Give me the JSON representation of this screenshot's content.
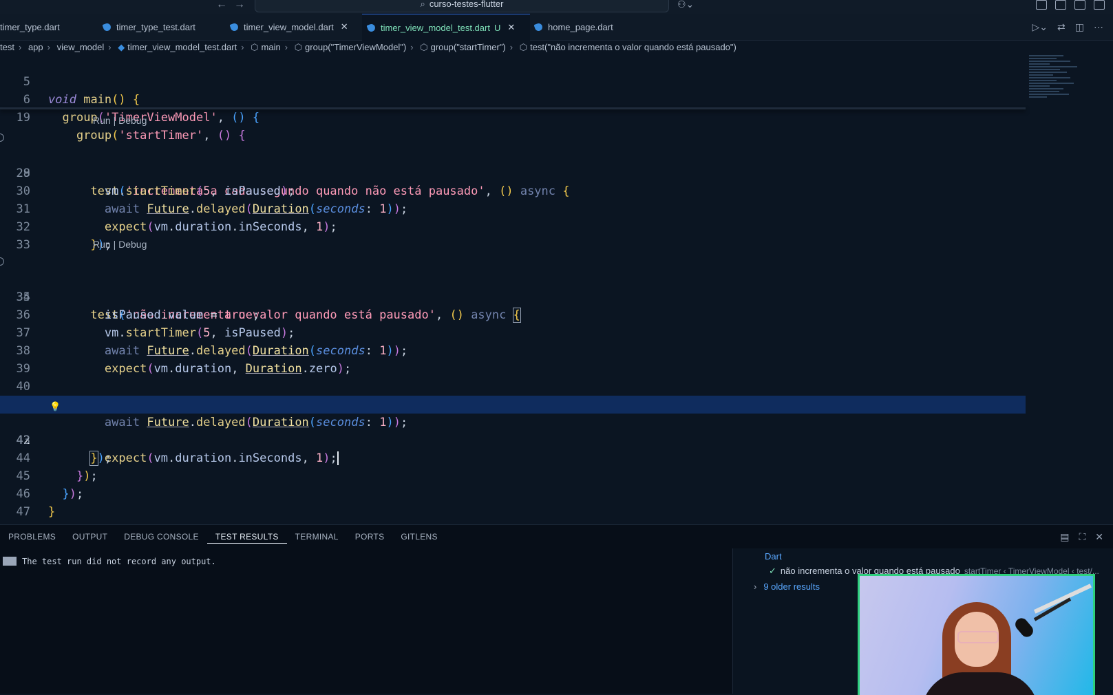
{
  "titlebar": {
    "search_text": "curso-testes-flutter"
  },
  "tabs": [
    {
      "label": "timer_type.dart"
    },
    {
      "label": "timer_type_test.dart"
    },
    {
      "label": "timer_view_model.dart"
    },
    {
      "label": "timer_view_model_test.dart",
      "modified": "U"
    },
    {
      "label": "home_page.dart"
    }
  ],
  "breadcrumb": [
    "test",
    "app",
    "view_model",
    "timer_view_model_test.dart",
    "main",
    "group(\"TimerViewModel\")",
    "group(\"startTimer\")",
    "test(\"não incrementa o valor quando está pausado\")"
  ],
  "codelens": {
    "label": "Run | Debug"
  },
  "line_numbers": [
    "5",
    "6",
    "19",
    "28",
    "29",
    "30",
    "31",
    "32",
    "33",
    "34",
    "35",
    "36",
    "37",
    "38",
    "39",
    "40",
    "41",
    "42",
    "43",
    "44",
    "45",
    "46",
    "47"
  ],
  "code_text": {
    "void": "void",
    "main": "main",
    "group": "group",
    "test": "test",
    "async": "async",
    "await": "await",
    "s_timervm": "'TimerViewModel'",
    "s_start": "'startTimer'",
    "s_test1": "'incrementa a cada segundo quando não está pausado'",
    "s_test2": "'não incrementa o valor quando está pausado'",
    "vm": "vm",
    "startTimer": "startTimer",
    "isPaused": "isPaused",
    "value": "value",
    "Future": "Future",
    "delayed": "delayed",
    "Duration": "Duration",
    "seconds": "seconds",
    "expect": "expect",
    "duration": "duration",
    "inSeconds": "inSeconds",
    "zero": "zero",
    "true": "true",
    "false": "false",
    "n5": "5",
    "n1": "1"
  },
  "panel": {
    "tabs": [
      "PROBLEMS",
      "OUTPUT",
      "DEBUG CONSOLE",
      "TEST RESULTS",
      "TERMINAL",
      "PORTS",
      "GITLENS"
    ],
    "output_text": "The test run did not record any output.",
    "results_header": "Dart",
    "result_item": "não incrementa o valor quando está pausado",
    "result_context": "startTimer ‹ TimerViewModel ‹ test/...",
    "older_results": "9 older results"
  }
}
